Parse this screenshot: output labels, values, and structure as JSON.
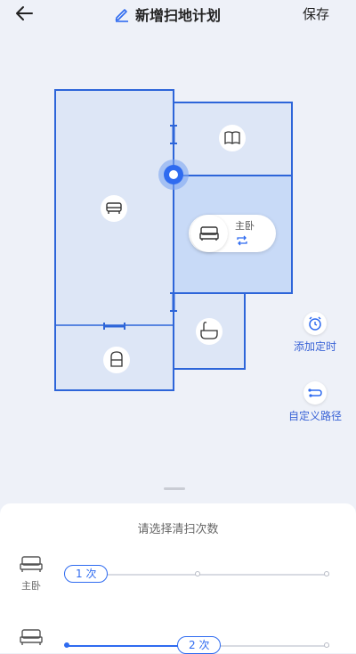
{
  "header": {
    "title": "新增扫地计划",
    "save_label": "保存"
  },
  "map": {
    "selected_room": {
      "name": "主卧"
    },
    "room_icons": [
      "sofa-icon",
      "book-icon",
      "bed-icon",
      "bathtub-icon",
      "armchair-icon"
    ]
  },
  "side_actions": {
    "add_timer_label": "添加定时",
    "custom_path_label": "自定义路径"
  },
  "sheet": {
    "title": "请选择清扫次数",
    "rows": [
      {
        "room_label": "主卧",
        "count_label": "1 次",
        "count": 1,
        "max": 3
      },
      {
        "room_label": "",
        "count_label": "2 次",
        "count": 2,
        "max": 3
      }
    ]
  },
  "colors": {
    "accent": "#2f6bf0",
    "room_fill": "#dde6f6",
    "selected_fill": "#c8daf7",
    "wall": "#2d65d9"
  }
}
